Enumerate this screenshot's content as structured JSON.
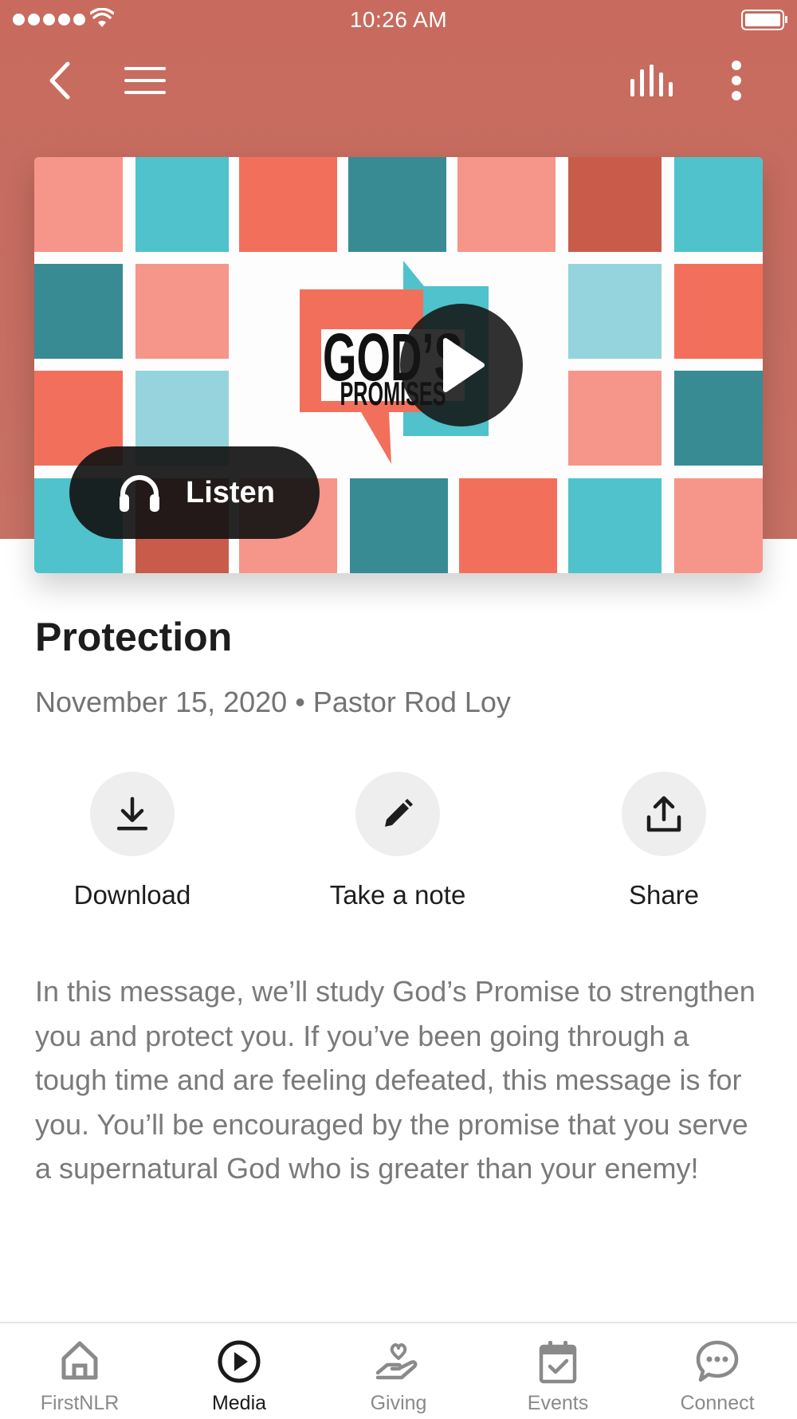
{
  "status_bar": {
    "time": "10:26 AM"
  },
  "colors": {
    "header": "#c86b5e",
    "tile_salmon": "#f6958a",
    "tile_teal_light": "#4fc2cc",
    "tile_coral": "#f2705b",
    "tile_teal_dark": "#388b92",
    "tile_red": "#c95b4b",
    "tile_pale_blue": "#95d4dc"
  },
  "icons": {
    "back": "chevron-left-icon",
    "menu": "hamburger-menu-icon",
    "audio": "audio-bars-icon",
    "more": "more-vertical-icon",
    "play": "play-icon",
    "listen": "headphones-icon"
  },
  "artwork": {
    "line1": "GOD’S",
    "line2": "PROMISES"
  },
  "listen_label": "Listen",
  "sermon": {
    "title": "Protection",
    "meta": "November 15, 2020 • Pastor Rod Loy",
    "description": "In this message, we’ll study God’s Promise to strengthen you and protect you.  If you’ve been going through a tough time and are feeling defeated, this message is for you.  You’ll be encouraged by the promise that you serve a supernatural God who is greater than your enemy!"
  },
  "actions": [
    {
      "label": "Download",
      "icon": "download-icon"
    },
    {
      "label": "Take a note",
      "icon": "pencil-icon"
    },
    {
      "label": "Share",
      "icon": "share-icon"
    }
  ],
  "tabs": [
    {
      "label": "FirstNLR",
      "icon": "home-icon",
      "active": false
    },
    {
      "label": "Media",
      "icon": "play-circle-icon",
      "active": true
    },
    {
      "label": "Giving",
      "icon": "giving-hand-heart-icon",
      "active": false
    },
    {
      "label": "Events",
      "icon": "calendar-check-icon",
      "active": false
    },
    {
      "label": "Connect",
      "icon": "chat-bubble-icon",
      "active": false
    }
  ]
}
